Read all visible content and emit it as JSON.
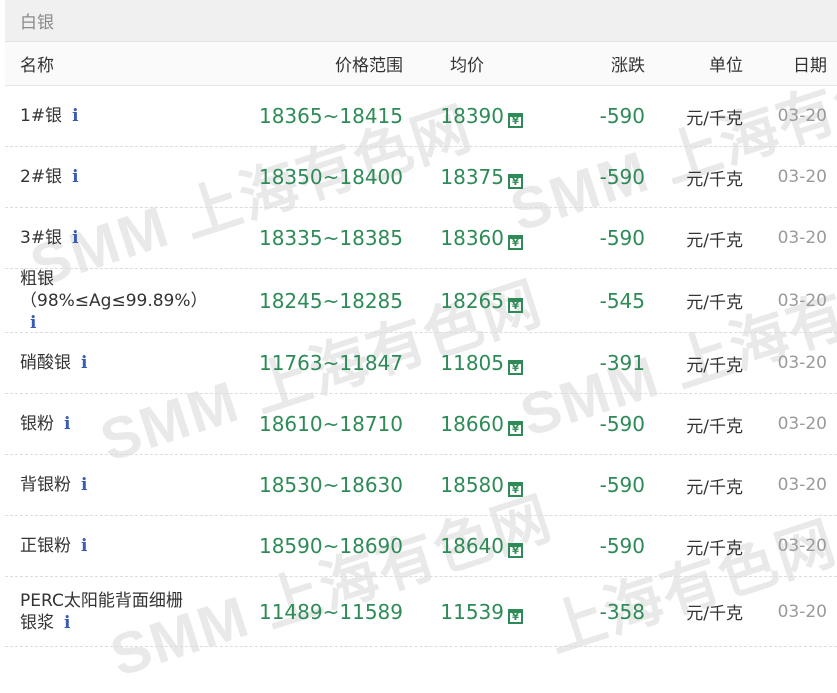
{
  "panel": {
    "title": "白银"
  },
  "headers": {
    "name": "名称",
    "range": "价格范围",
    "avg": "均价",
    "change": "涨跌",
    "unit": "单位",
    "date": "日期"
  },
  "watermark": [
    "SMM 上海有色网",
    "SMM 上海有色网",
    "SMM 上海有色网",
    "SMM 上海有色网",
    "SMM 上海有色网",
    "上海有色网"
  ],
  "rows": [
    {
      "name": "1#银",
      "range": "18365~18415",
      "avg": "18390",
      "change": "-590",
      "unit": "元/千克",
      "date": "03-20"
    },
    {
      "name": "2#银",
      "range": "18350~18400",
      "avg": "18375",
      "change": "-590",
      "unit": "元/千克",
      "date": "03-20"
    },
    {
      "name": "3#银",
      "range": "18335~18385",
      "avg": "18360",
      "change": "-590",
      "unit": "元/千克",
      "date": "03-20"
    },
    {
      "name": "粗银",
      "name_sub": "（98%≤Ag≤99.89%）",
      "range": "18245~18285",
      "avg": "18265",
      "change": "-545",
      "unit": "元/千克",
      "date": "03-20"
    },
    {
      "name": "硝酸银",
      "range": "11763~11847",
      "avg": "11805",
      "change": "-391",
      "unit": "元/千克",
      "date": "03-20"
    },
    {
      "name": "银粉",
      "range": "18610~18710",
      "avg": "18660",
      "change": "-590",
      "unit": "元/千克",
      "date": "03-20"
    },
    {
      "name": "背银粉",
      "range": "18530~18630",
      "avg": "18580",
      "change": "-590",
      "unit": "元/千克",
      "date": "03-20"
    },
    {
      "name": "正银粉",
      "range": "18590~18690",
      "avg": "18640",
      "change": "-590",
      "unit": "元/千克",
      "date": "03-20"
    },
    {
      "name": "PERC太阳能背面细栅",
      "name_sub": "银浆",
      "range": "11489~11589",
      "avg": "11539",
      "change": "-358",
      "unit": "元/千克",
      "date": "03-20"
    }
  ],
  "icons": {
    "info": "info-icon",
    "calendar": "yuan-calendar-icon"
  },
  "colors": {
    "price_green": "#2e8b57",
    "info_blue": "#3a5db4",
    "header_bg": "#f0f0f0"
  }
}
